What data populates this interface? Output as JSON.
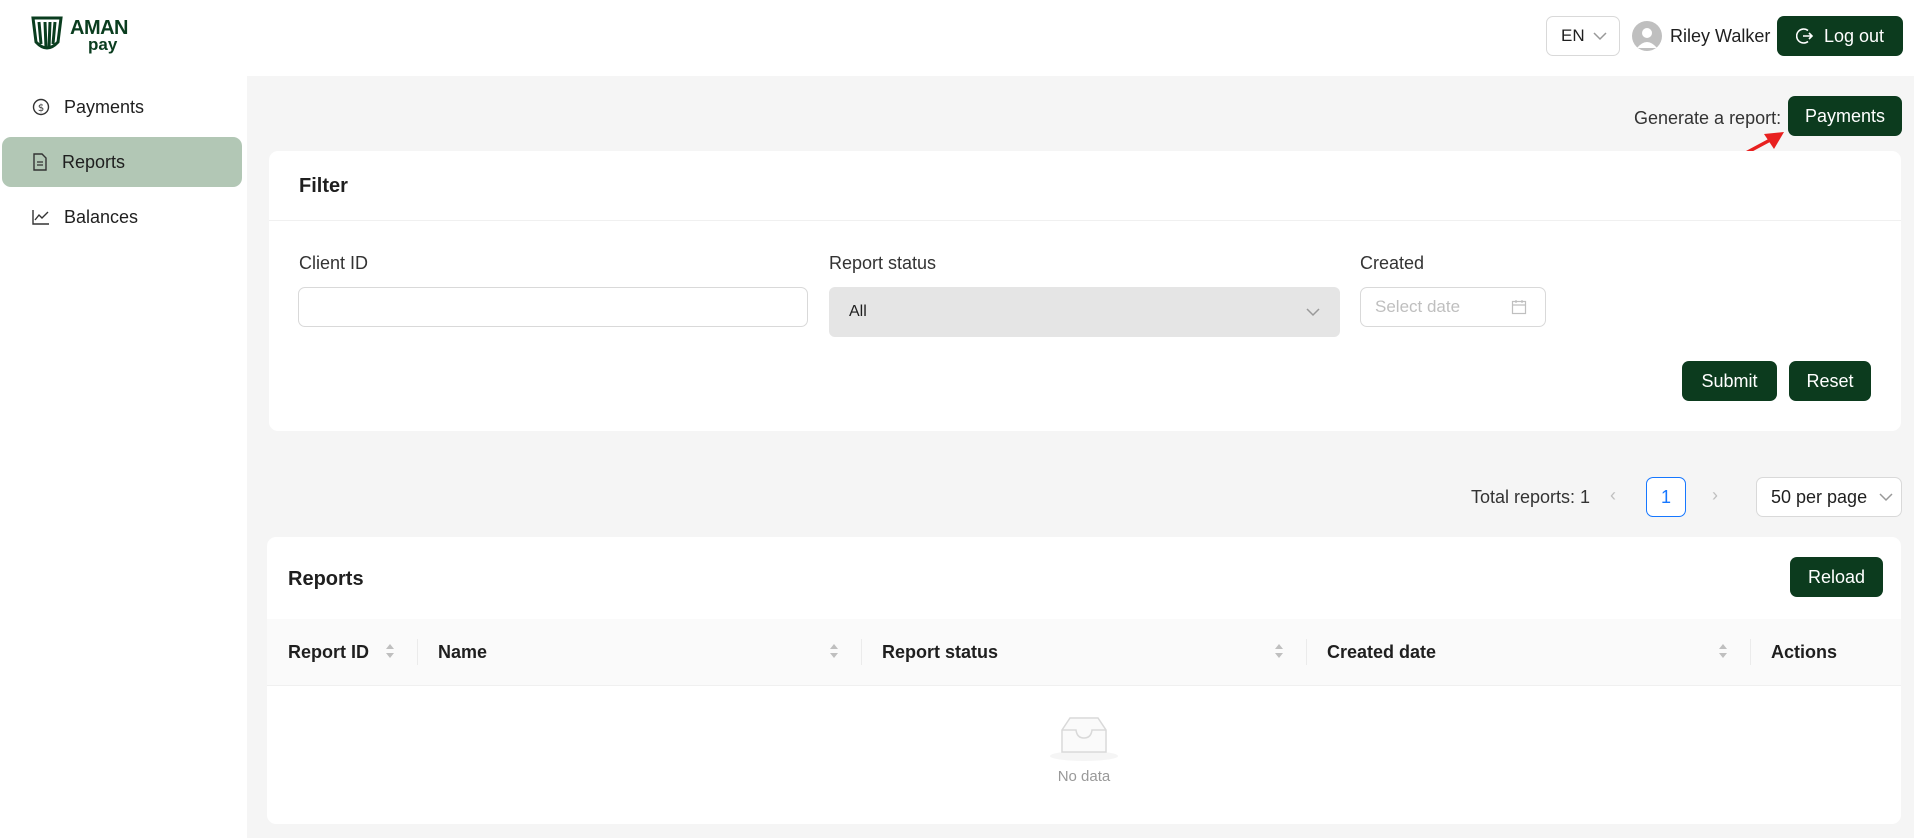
{
  "brand": {
    "line1": "AMAN",
    "line2": "pay"
  },
  "header": {
    "language": "EN",
    "user_name": "Riley Walker",
    "logout_label": "Log out"
  },
  "sidebar": {
    "items": [
      {
        "label": "Payments",
        "icon": "dollar-circle-icon",
        "active": false
      },
      {
        "label": "Reports",
        "icon": "file-text-icon",
        "active": true
      },
      {
        "label": "Balances",
        "icon": "line-chart-icon",
        "active": false
      }
    ]
  },
  "generate": {
    "label": "Generate a report:",
    "button_label": "Payments"
  },
  "filter": {
    "title": "Filter",
    "client_id": {
      "label": "Client ID",
      "value": ""
    },
    "report_status": {
      "label": "Report status",
      "value": "All"
    },
    "created": {
      "label": "Created",
      "placeholder": "Select date"
    },
    "submit_label": "Submit",
    "reset_label": "Reset"
  },
  "pagination": {
    "total_label": "Total reports: 1",
    "current_page": "1",
    "per_page": "50 per page"
  },
  "reports": {
    "title": "Reports",
    "reload_label": "Reload",
    "columns": [
      "Report ID",
      "Name",
      "Report status",
      "Created date",
      "Actions"
    ],
    "rows": [],
    "empty_text": "No data"
  },
  "colors": {
    "accent": "#0c3b1e",
    "active_nav": "#b2c7b5",
    "annotation_arrow": "#e8201f",
    "link": "#1677ff"
  }
}
